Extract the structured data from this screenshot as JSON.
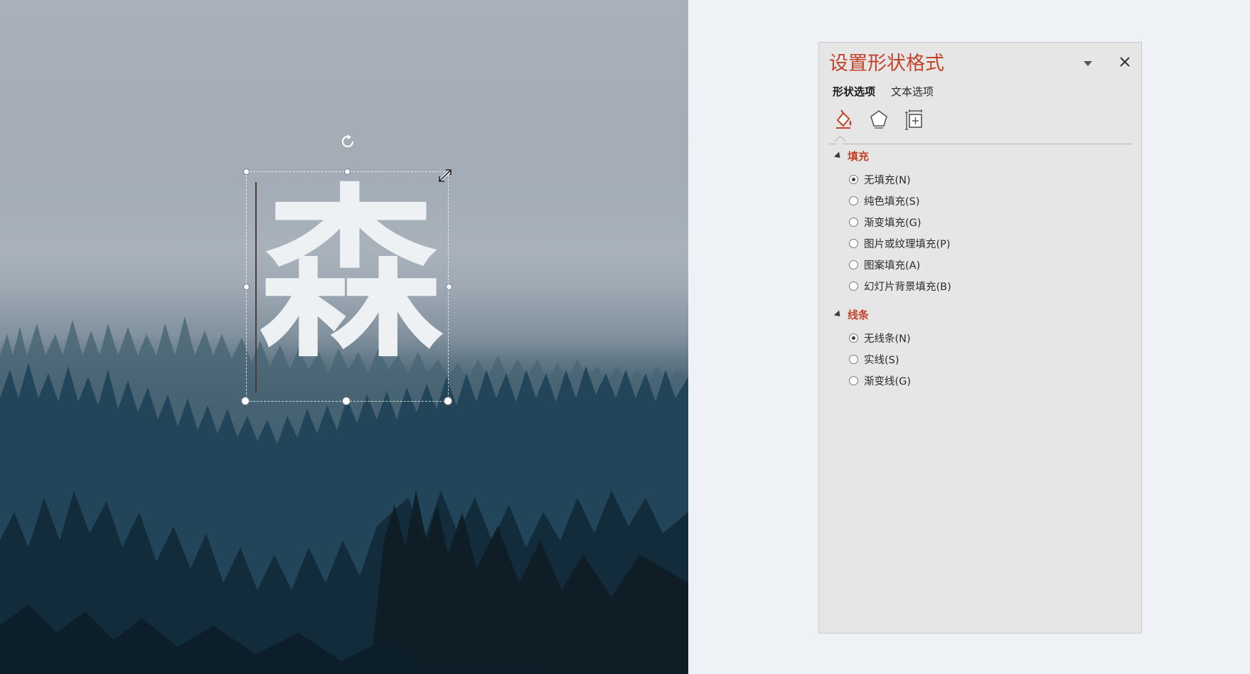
{
  "slide": {
    "text_box": {
      "character": "森"
    }
  },
  "format_pane": {
    "title": "设置形状格式",
    "tabs": [
      {
        "label": "形状选项",
        "active": true
      },
      {
        "label": "文本选项",
        "active": false
      }
    ],
    "icons": [
      "fill-line-icon",
      "effects-pentagon-icon",
      "size-properties-icon"
    ],
    "sections": [
      {
        "header": "填充",
        "options": [
          {
            "label": "无填充(N)",
            "checked": true
          },
          {
            "label": "纯色填充(S)",
            "checked": false
          },
          {
            "label": "渐变填充(G)",
            "checked": false
          },
          {
            "label": "图片或纹理填充(P)",
            "checked": false
          },
          {
            "label": "图案填充(A)",
            "checked": false
          },
          {
            "label": "幻灯片背景填充(B)",
            "checked": false
          }
        ]
      },
      {
        "header": "线条",
        "options": [
          {
            "label": "无线条(N)",
            "checked": true
          },
          {
            "label": "实线(S)",
            "checked": false
          },
          {
            "label": "渐变线(G)",
            "checked": false
          }
        ]
      }
    ]
  },
  "colors": {
    "accent": "#c2452b",
    "pane_background": "#e6e6e6",
    "app_background": "#eef2f6"
  }
}
